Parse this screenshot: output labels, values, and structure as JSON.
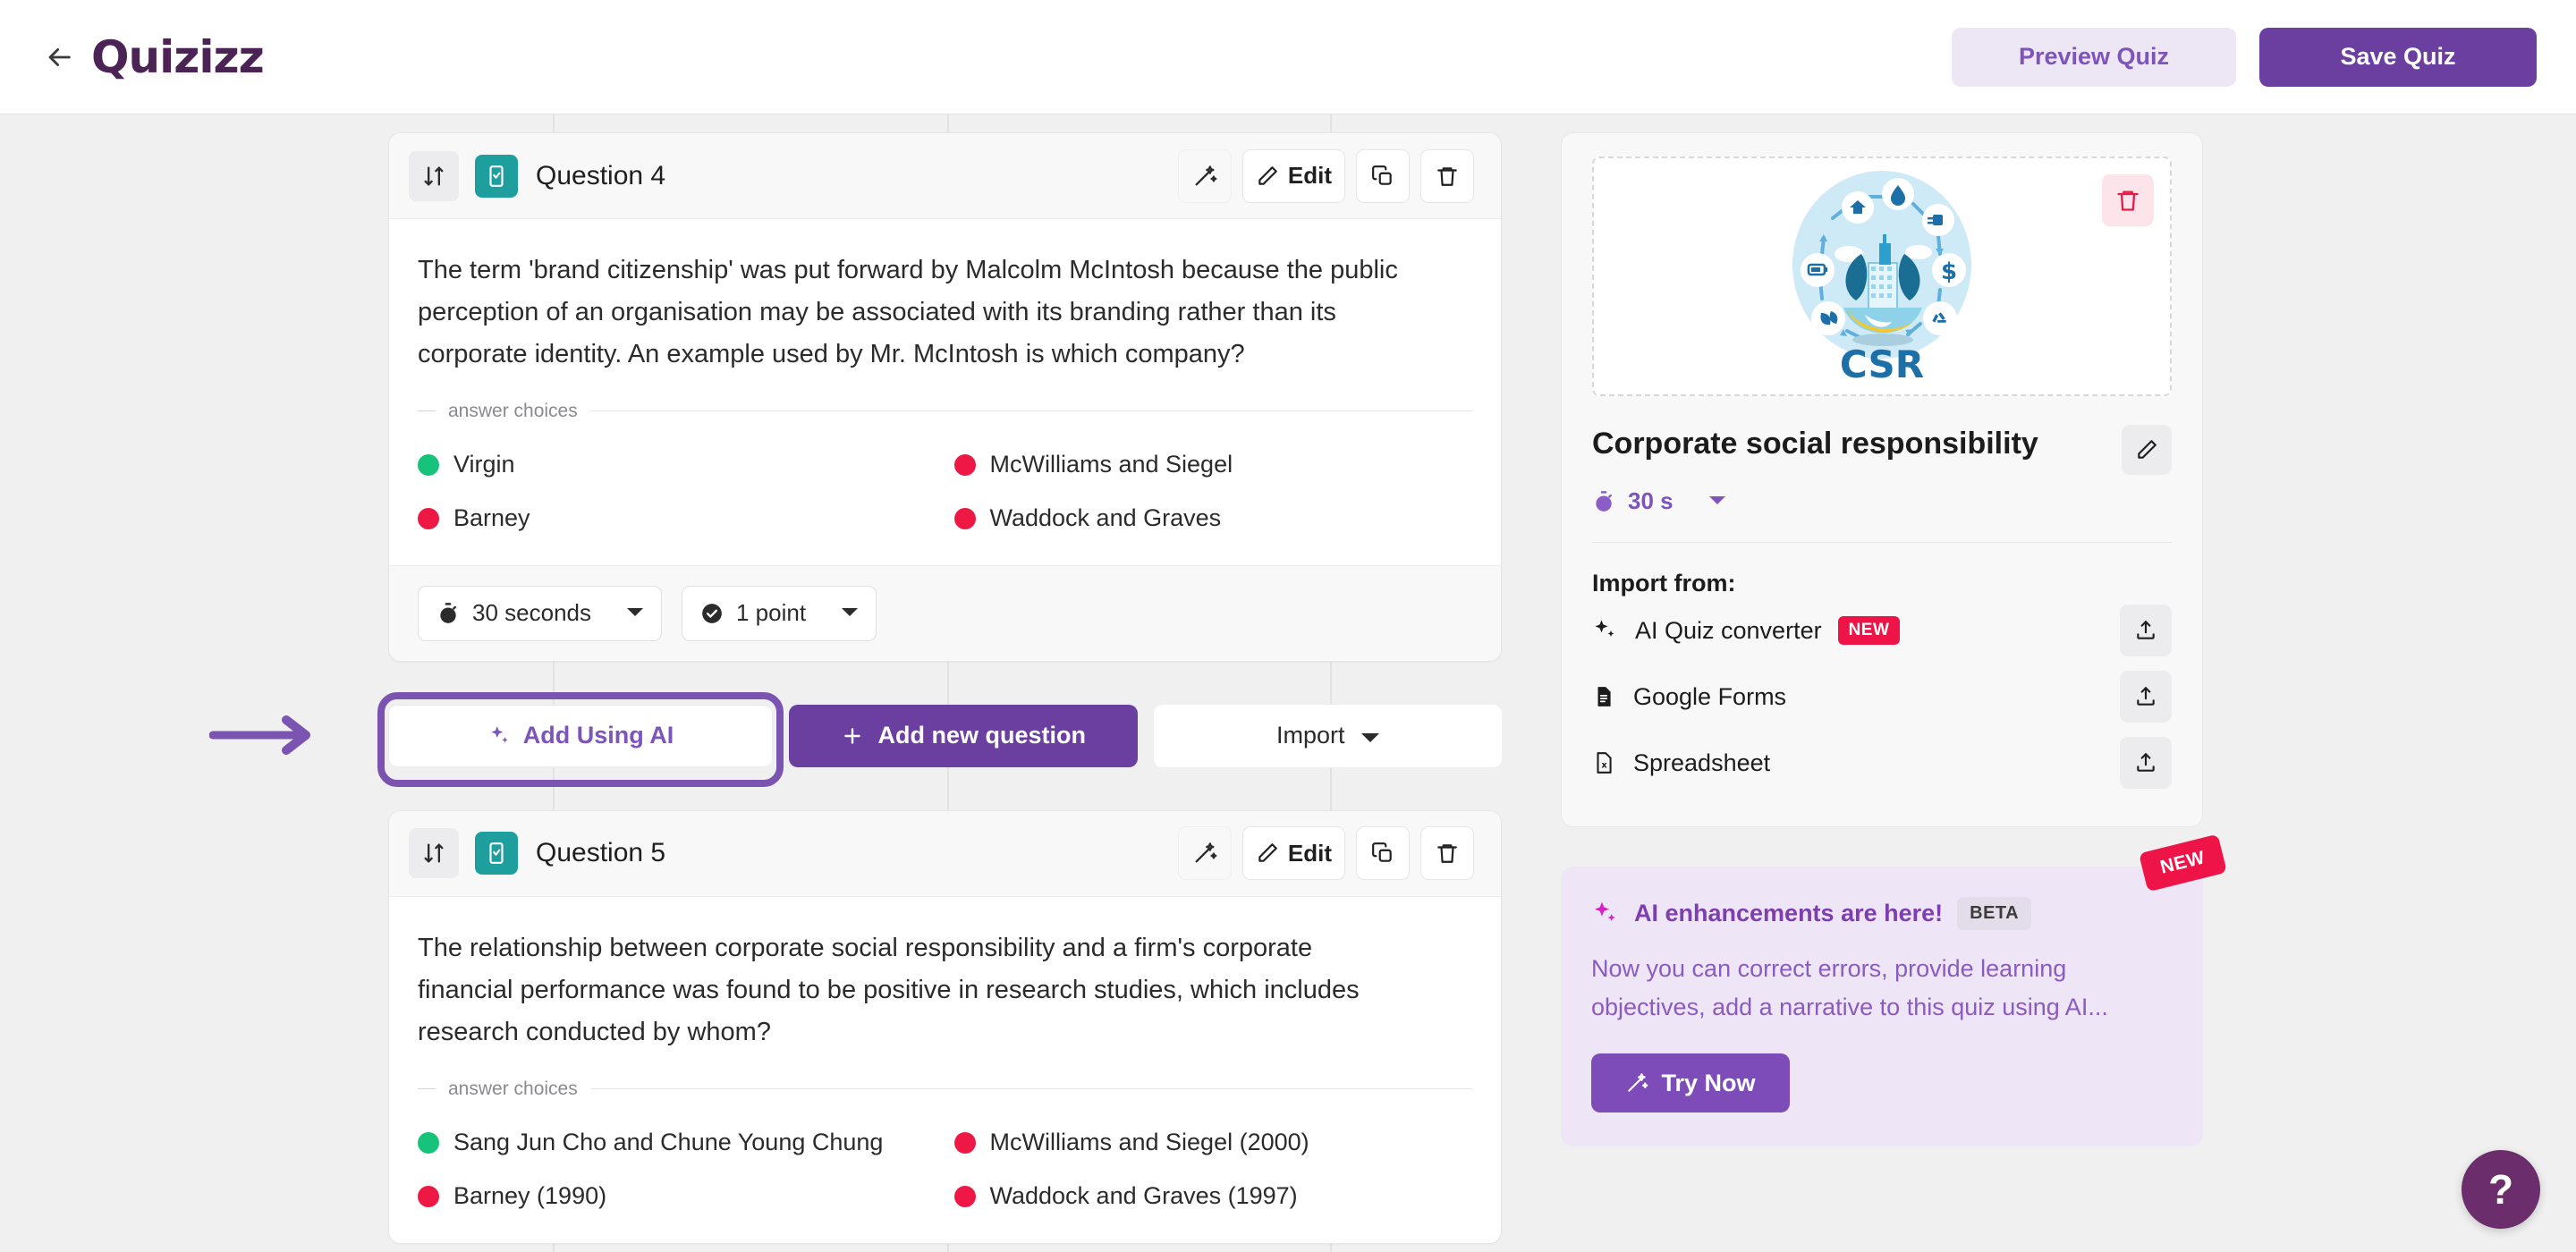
{
  "header": {
    "back_icon": "arrow-left-icon",
    "logo_text": "Quizizz",
    "preview_label": "Preview Quiz",
    "save_label": "Save Quiz"
  },
  "questions": [
    {
      "title": "Question 4",
      "type_icon": "multiple-choice-icon",
      "sort_icon": "sort-updown-icon",
      "magic_icon": "magic-wand-icon",
      "edit_label": "Edit",
      "edit_icon": "pencil-icon",
      "duplicate_icon": "duplicate-icon",
      "delete_icon": "trash-icon",
      "text": "The term 'brand citizenship' was put forward by Malcolm McIntosh because the public perception of an organisation may be associated with its branding rather than its corporate identity. An example used by Mr. McIntosh is which company?",
      "choices_label": "answer choices",
      "choices": [
        {
          "text": "Virgin",
          "correct": true
        },
        {
          "text": "McWilliams and Siegel",
          "correct": false
        },
        {
          "text": "Barney",
          "correct": false
        },
        {
          "text": "Waddock and Graves",
          "correct": false
        }
      ],
      "time_value": "30 seconds",
      "time_icon": "stopwatch-icon",
      "points_value": "1 point",
      "points_icon": "check-circle-icon"
    },
    {
      "title": "Question 5",
      "type_icon": "multiple-choice-icon",
      "sort_icon": "sort-updown-icon",
      "magic_icon": "magic-wand-icon",
      "edit_label": "Edit",
      "edit_icon": "pencil-icon",
      "duplicate_icon": "duplicate-icon",
      "delete_icon": "trash-icon",
      "text": "The relationship between corporate social responsibility and a firm's corporate financial performance was found to be positive in research studies, which includes research conducted by whom?",
      "choices_label": "answer choices",
      "choices": [
        {
          "text": "Sang Jun Cho and Chune Young Chung",
          "correct": true
        },
        {
          "text": "McWilliams and Siegel (2000)",
          "correct": false
        },
        {
          "text": "Barney (1990)",
          "correct": false
        },
        {
          "text": "Waddock and Graves (1997)",
          "correct": false
        }
      ]
    }
  ],
  "actions": {
    "add_ai_label": "Add Using AI",
    "add_ai_icon": "sparkle-icon",
    "add_question_label": "Add new question",
    "add_question_icon": "plus-icon",
    "import_label": "Import",
    "import_caret_icon": "chevron-down-icon",
    "annotation_arrow_icon": "arrow-right-annotation-icon"
  },
  "sidebar": {
    "thumbnail_alt": "CSR illustration",
    "thumbnail_caption": "CSR",
    "delete_image_icon": "trash-icon",
    "quiz_title": "Corporate social responsibility",
    "edit_title_icon": "pencil-icon",
    "quiz_time": "30 s",
    "quiz_time_icon": "stopwatch-icon",
    "quiz_time_caret_icon": "chevron-down-icon",
    "import_heading": "Import from:",
    "import_items": [
      {
        "label": "AI Quiz converter",
        "icon": "sparkle-icon",
        "badge": "NEW",
        "upload_icon": "upload-icon"
      },
      {
        "label": "Google Forms",
        "icon": "document-icon",
        "badge": "",
        "upload_icon": "upload-icon"
      },
      {
        "label": "Spreadsheet",
        "icon": "spreadsheet-icon",
        "badge": "",
        "upload_icon": "upload-icon"
      }
    ]
  },
  "ai_promo": {
    "ribbon": "NEW",
    "icon": "sparkle-icon",
    "heading": "AI enhancements are here!",
    "badge": "BETA",
    "description": "Now you can correct errors, provide learning objectives, add a narrative to this quiz using AI...",
    "button_label": "Try Now",
    "button_icon": "magic-wand-icon"
  },
  "help": {
    "label": "?",
    "icon": "question-mark-icon"
  },
  "colors": {
    "brand_purple": "#6b3fa0",
    "accent_purple": "#7d54ba",
    "annotation_purple": "#7b53b0",
    "logo_purple": "#4b2354",
    "correct_green": "#17c37b",
    "wrong_red": "#ed1944",
    "badge_red": "#ef1447",
    "teal": "#1f9e9e",
    "page_bg": "#f0f0f0"
  }
}
